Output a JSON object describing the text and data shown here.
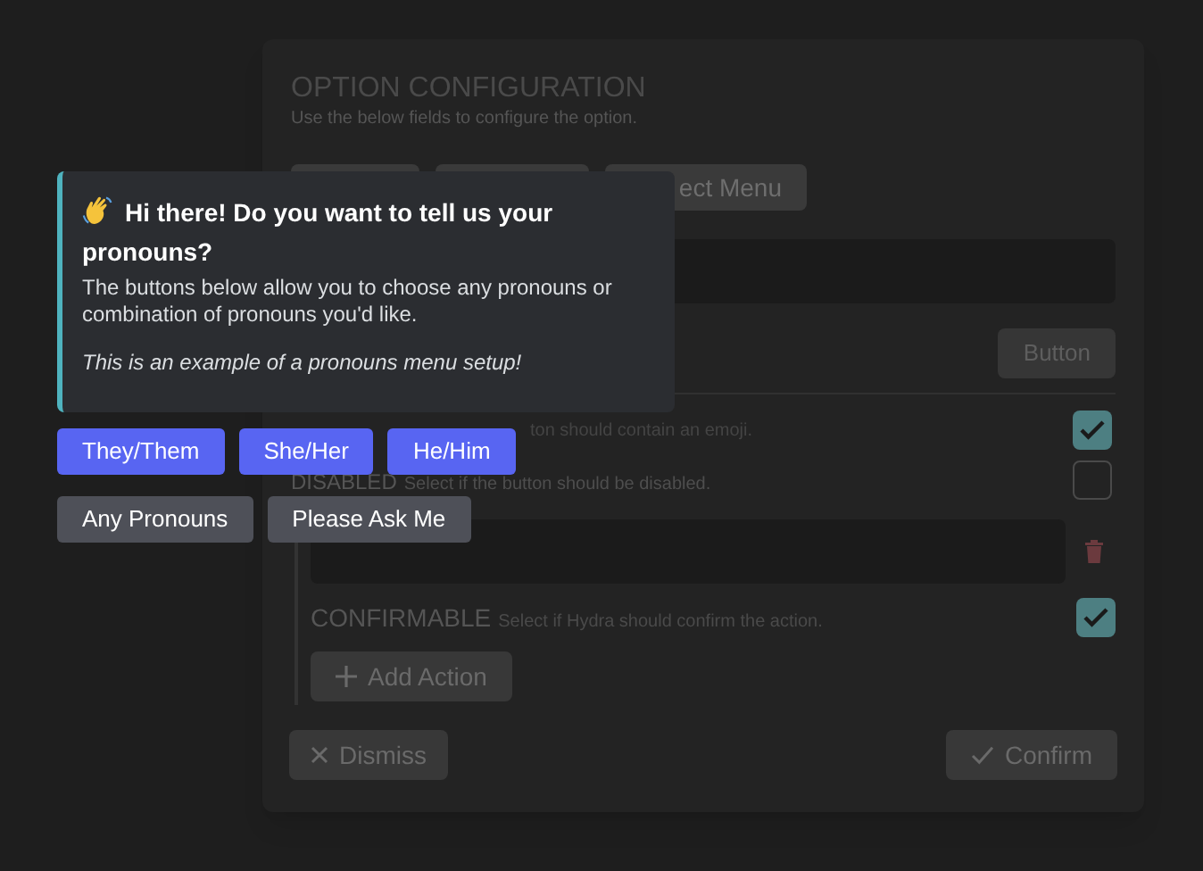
{
  "panel": {
    "title": "OPTION CONFIGURATION",
    "subtitle": "Use the below fields to configure the option.",
    "tabs": [
      {
        "kind": "covered"
      },
      {
        "kind": "covered"
      },
      {
        "kind": "labeled",
        "label": "ect Menu"
      }
    ],
    "style_button": "Button",
    "options": [
      {
        "kind": "covered",
        "description": "ton should contain an emoji.",
        "checked": true
      },
      {
        "kind": "full",
        "label": "DISABLED",
        "description": "Select if the button should be disabled.",
        "checked": false
      }
    ],
    "action": {
      "confirmable_label": "CONFIRMABLE",
      "confirmable_description": "Select if Hydra should confirm the action.",
      "confirmable_checked": true,
      "add_button": "Add Action"
    },
    "dismiss_button": "Dismiss",
    "confirm_button": "Confirm"
  },
  "message": {
    "title": "Hi there! Do you want to tell us your pronouns?",
    "body": "The buttons below allow you to choose any pronouns or combination of pronouns you'd like.",
    "note": "This is an example of a pronouns menu setup!"
  },
  "button_rows": [
    [
      {
        "label": "They/Them"
      },
      {
        "label": "She/Her"
      },
      {
        "label": "He/Him"
      }
    ],
    [
      {
        "label": "Any Pronouns"
      },
      {
        "label": "Please Ask Me"
      }
    ]
  ]
}
